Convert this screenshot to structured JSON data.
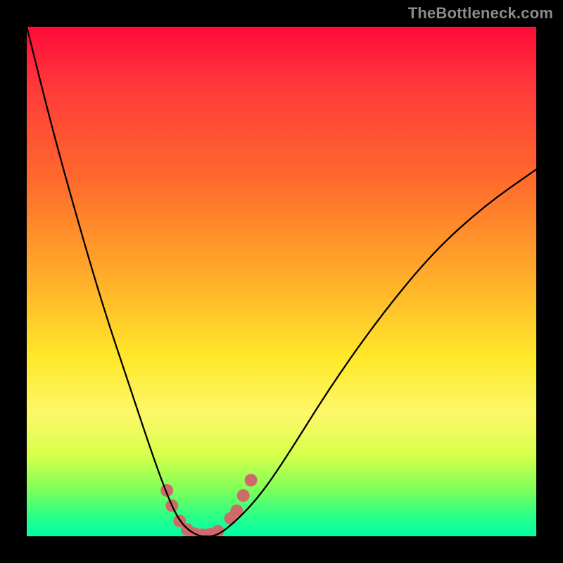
{
  "watermark": "TheBottleneck.com",
  "chart_data": {
    "type": "line",
    "title": "",
    "xlabel": "",
    "ylabel": "",
    "xlim": [
      0,
      100
    ],
    "ylim": [
      0,
      100
    ],
    "grid": false,
    "legend": false,
    "series": [
      {
        "name": "curve",
        "x": [
          0,
          5,
          10,
          15,
          20,
          25,
          28,
          30,
          32,
          34,
          35,
          37,
          40,
          45,
          50,
          60,
          70,
          80,
          90,
          100
        ],
        "y": [
          100,
          80,
          62,
          45,
          30,
          15,
          7,
          3,
          1,
          0,
          0,
          0,
          2,
          7,
          14,
          30,
          44,
          56,
          65,
          72
        ]
      }
    ],
    "markers": [
      {
        "x": 27.5,
        "y": 9
      },
      {
        "x": 28.5,
        "y": 6
      },
      {
        "x": 30,
        "y": 3
      },
      {
        "x": 31.5,
        "y": 1.3
      },
      {
        "x": 33,
        "y": 0.5
      },
      {
        "x": 34.5,
        "y": 0.3
      },
      {
        "x": 36,
        "y": 0.4
      },
      {
        "x": 37.5,
        "y": 1.0
      },
      {
        "x": 40,
        "y": 3.5
      },
      {
        "x": 41.2,
        "y": 5
      },
      {
        "x": 42.5,
        "y": 8
      },
      {
        "x": 44,
        "y": 11
      }
    ],
    "marker_radius": 9
  }
}
